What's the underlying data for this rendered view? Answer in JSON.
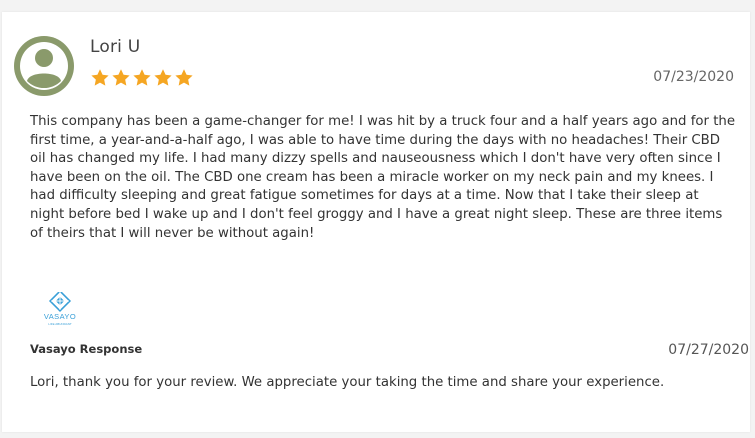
{
  "review": {
    "reviewer_name": "Lori U",
    "rating": 5,
    "rating_max": 5,
    "date": "07/23/2020",
    "body": "This company has been a game-changer for me! I was hit by a truck four and a half years ago and for the first time, a year-and-a-half ago, I was able to have time during the days with no headaches! Their CBD oil has changed my life. I had many dizzy spells and nauseousness which I don't have very often since I have been on the oil. The CBD one cream has been a miracle worker on my neck pain and my knees. I had difficulty sleeping and great fatigue sometimes for days at a time. Now that I take their sleep at night before bed I wake up and I don't feel groggy and I have a great night sleep. These are three items of theirs that I will never be without again!",
    "avatar_icon": "user-avatar-icon",
    "avatar_color": "#8a9a6b",
    "star_color": "#f5a623"
  },
  "response": {
    "logo_text": "VASAYO",
    "logo_tagline": "LIFE ABUNDANT",
    "logo_color": "#3aa0d8",
    "author": "Vasayo Response",
    "date": "07/27/2020",
    "body": "Lori, thank you for your review. We appreciate your taking the time and share your experience."
  }
}
